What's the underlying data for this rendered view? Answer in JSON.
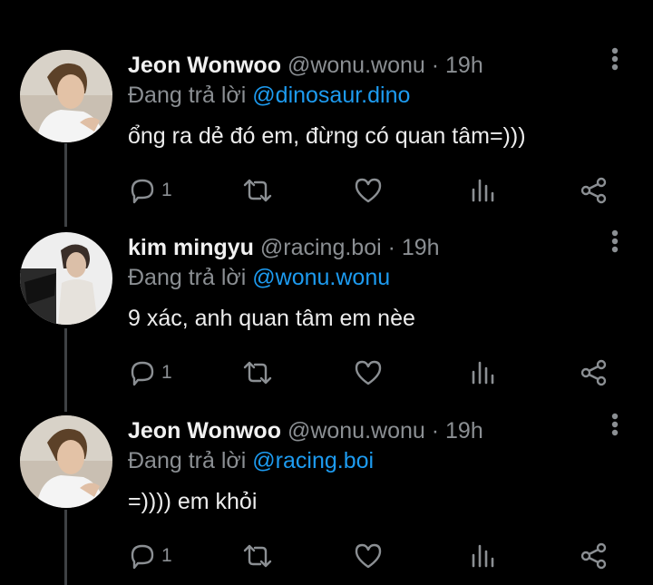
{
  "colors": {
    "background": "#000000",
    "mention": "#1d9bf0",
    "muted": "#8b8f93",
    "thread_line": "#3e4144"
  },
  "tweets": [
    {
      "name": "Jeon Wonwoo",
      "handle": "@wonu.wonu",
      "time": "19h",
      "reply_prefix": "Đang trả lời ",
      "reply_to": "@dinosaur.dino",
      "text": "ổng ra dẻ đó em, đừng có quan tâm=)))",
      "reply_count": "1",
      "avatar_icon": "profile-photo"
    },
    {
      "name": "kim mingyu",
      "handle": "@racing.boi",
      "time": "19h",
      "reply_prefix": "Đang trả lời ",
      "reply_to": "@wonu.wonu",
      "text": "9 xác, anh quan tâm em nèe",
      "reply_count": "1",
      "avatar_icon": "profile-photo"
    },
    {
      "name": "Jeon Wonwoo",
      "handle": "@wonu.wonu",
      "time": "19h",
      "reply_prefix": "Đang trả lời ",
      "reply_to": "@racing.boi",
      "text": "=)))) em khỏi",
      "reply_count": "1",
      "avatar_icon": "profile-photo"
    }
  ],
  "separator": " · ",
  "icons": [
    "reply-icon",
    "retweet-icon",
    "like-icon",
    "analytics-icon",
    "share-icon",
    "more-icon"
  ]
}
